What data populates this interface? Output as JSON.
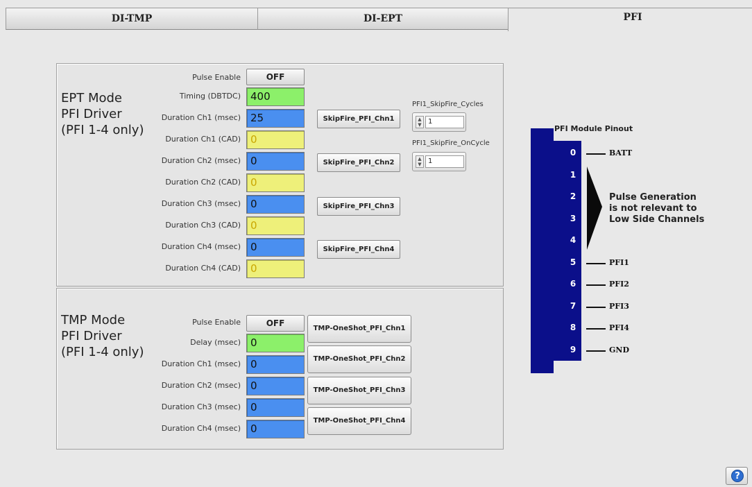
{
  "tabs": [
    {
      "label": "DI-TMP"
    },
    {
      "label": "DI-EPT"
    },
    {
      "label": "PFI"
    }
  ],
  "ept": {
    "title_line1": "EPT Mode",
    "title_line2": "PFI Driver",
    "title_line3": "(PFI 1-4 only)",
    "pulse_enable_label": "Pulse Enable",
    "pulse_enable_value": "OFF",
    "fields": [
      {
        "label": "Timing (DBTDC)",
        "value": "400",
        "color": "#8cf06a"
      },
      {
        "label": "Duration Ch1 (msec)",
        "value": "25",
        "color": "#4a8ff0"
      },
      {
        "label": "Duration Ch1  (CAD)",
        "value": "0",
        "color": "#eef07a"
      },
      {
        "label": "Duration Ch2 (msec)",
        "value": "0",
        "color": "#4a8ff0"
      },
      {
        "label": "Duration Ch2  (CAD)",
        "value": "0",
        "color": "#eef07a"
      },
      {
        "label": "Duration Ch3 (msec)",
        "value": "0",
        "color": "#4a8ff0"
      },
      {
        "label": "Duration Ch3  (CAD)",
        "value": "0",
        "color": "#eef07a"
      },
      {
        "label": "Duration Ch4 (msec)",
        "value": "0",
        "color": "#4a8ff0"
      },
      {
        "label": "Duration Ch4  (CAD)",
        "value": "0",
        "color": "#eef07a"
      }
    ],
    "skip_buttons": [
      {
        "label": "SkipFire_PFI_Chn1"
      },
      {
        "label": "SkipFire_PFI_Chn2"
      },
      {
        "label": "SkipFire_PFI_Chn3"
      },
      {
        "label": "SkipFire_PFI_Chn4"
      }
    ],
    "skip_cycles_label": "PFI1_SkipFire_Cycles",
    "skip_cycles_value": "1",
    "skip_oncycle_label": "PFI1_SkipFire_OnCycle",
    "skip_oncycle_value": "1"
  },
  "tmp": {
    "title_line1": "TMP Mode",
    "title_line2": "PFI Driver",
    "title_line3": "(PFI 1-4 only)",
    "pulse_enable_label": "Pulse Enable",
    "pulse_enable_value": "OFF",
    "fields": [
      {
        "label": "Delay  (msec)",
        "value": "0",
        "color": "#8cf06a"
      },
      {
        "label": "Duration Ch1 (msec)",
        "value": "0",
        "color": "#4a8ff0"
      },
      {
        "label": "Duration Ch2 (msec)",
        "value": "0",
        "color": "#4a8ff0"
      },
      {
        "label": "Duration Ch3 (msec)",
        "value": "0",
        "color": "#4a8ff0"
      },
      {
        "label": "Duration Ch4 (msec)",
        "value": "0",
        "color": "#4a8ff0"
      }
    ],
    "oneshot_buttons": [
      {
        "label": "TMP-OneShot_PFI_Chn1"
      },
      {
        "label": "TMP-OneShot_PFI_Chn2"
      },
      {
        "label": "TMP-OneShot_PFI_Chn3"
      },
      {
        "label": "TMP-OneShot_PFI_Chn4"
      }
    ]
  },
  "pinout": {
    "title": "PFI Module Pinout",
    "connector_color": "#0b0f8a",
    "pins": [
      {
        "num": "0",
        "label": "BATT"
      },
      {
        "num": "1",
        "label": ""
      },
      {
        "num": "2",
        "label": ""
      },
      {
        "num": "3",
        "label": ""
      },
      {
        "num": "4",
        "label": ""
      },
      {
        "num": "5",
        "label": "PFI1"
      },
      {
        "num": "6",
        "label": "PFI2"
      },
      {
        "num": "7",
        "label": "PFI3"
      },
      {
        "num": "8",
        "label": "PFI4"
      },
      {
        "num": "9",
        "label": "GND"
      }
    ],
    "note_line1": "Pulse Generation",
    "note_line2": "is not relevant to",
    "note_line3": "Low Side Channels"
  },
  "help": {
    "icon": "help-icon",
    "symbol": "?"
  }
}
